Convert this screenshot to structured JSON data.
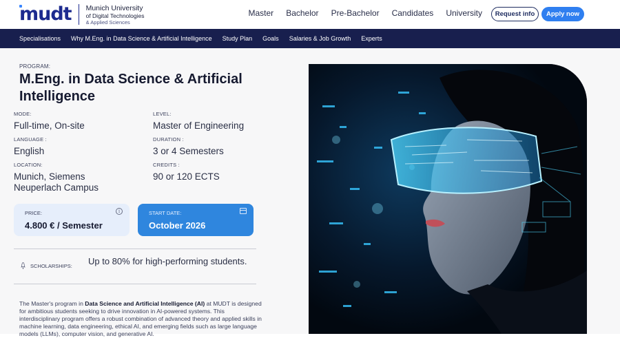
{
  "header": {
    "logo_word": "mudt",
    "logo_line1": "Munich University",
    "logo_line2": "of Digital Technologies",
    "logo_line3": "& Applied Sciences",
    "nav": [
      "Master",
      "Bachelor",
      "Pre-Bachelor",
      "Candidates",
      "University"
    ],
    "request_label": "Request info",
    "apply_label": "Apply now"
  },
  "subnav": [
    "Specialisations",
    "Why M.Eng. in Data Science & Artificial Intelligence",
    "Study Plan",
    "Goals",
    "Salaries & Job Growth",
    "Experts"
  ],
  "program": {
    "label": "PROGRAM:",
    "title": "M.Eng. in Data Science & Artificial Intelligence"
  },
  "fields": {
    "mode_key": "MODE:",
    "mode_val": "Full-time, On-site",
    "level_key": "LEVEL:",
    "level_val": "Master of Engineering",
    "language_key": "LANGUAGE :",
    "language_val": "English",
    "duration_key": "DURATION :",
    "duration_val": "3 or 4 Semesters",
    "location_key": "LOCATION:",
    "location_val": "Munich, Siemens Neuperlach Campus",
    "credits_key": "CREDITS :",
    "credits_val": "90 or 120 ECTS"
  },
  "price": {
    "key": "PRICE:",
    "value": "4.800 € / Semester",
    "icon": "info-icon"
  },
  "start": {
    "key": "START DATE:",
    "value": "October 2026",
    "icon": "calendar-icon"
  },
  "scholarship": {
    "key": "SCHOLARSHIPS:",
    "value": "Up to 80% for high-performing students.",
    "icon": "rocket-icon"
  },
  "description": {
    "pre": "The Master's program in ",
    "bold": "Data Science and Artificial Intelligence (AI)",
    "post": " at MUDT is designed for ambitious students seeking to drive innovation in AI-powered systems. This interdisciplinary program offers a robust combination of advanced theory and applied skills in machine learning, data engineering, ethical AI, and emerging fields such as large language models (LLMs), computer vision, and generative AI."
  },
  "colors": {
    "navy": "#181f4e",
    "accent_blue": "#2f86de",
    "card_light": "#e6eefb"
  }
}
